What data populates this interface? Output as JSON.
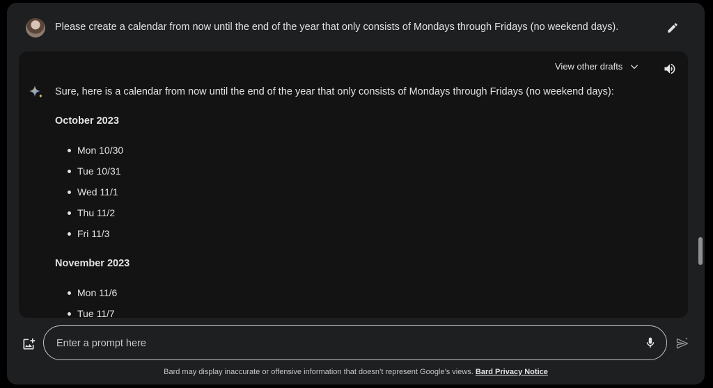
{
  "user": {
    "prompt": "Please create a calendar from now until the end of the year that only consists of Mondays through Fridays (no weekend days)."
  },
  "response": {
    "drafts_label": "View other drafts",
    "intro": "Sure, here is a calendar from now until the end of the year that only consists of Mondays through Fridays (no weekend days):",
    "months": [
      {
        "title": "October 2023",
        "days": [
          "Mon 10/30",
          "Tue 10/31",
          "Wed 11/1",
          "Thu 11/2",
          "Fri 11/3"
        ]
      },
      {
        "title": "November 2023",
        "days": [
          "Mon 11/6",
          "Tue 11/7"
        ]
      }
    ]
  },
  "prompt_bar": {
    "placeholder": "Enter a prompt here"
  },
  "footer": {
    "disclaimer": "Bard may display inaccurate or offensive information that doesn’t represent Google’s views.",
    "privacy_link": "Bard Privacy Notice"
  },
  "colors": {
    "background": "#1e1f20",
    "response_card": "#131314",
    "text": "#e3e3e3",
    "spark_blue": "#4f8df5",
    "spark_gold": "#e8c46a"
  },
  "icons": {
    "edit": "pencil-icon",
    "drafts": "chevron-down-icon",
    "speaker": "speaker-icon",
    "bard": "sparkle-icon",
    "image_upload": "image-add-icon",
    "mic": "microphone-icon",
    "send": "send-icon"
  }
}
